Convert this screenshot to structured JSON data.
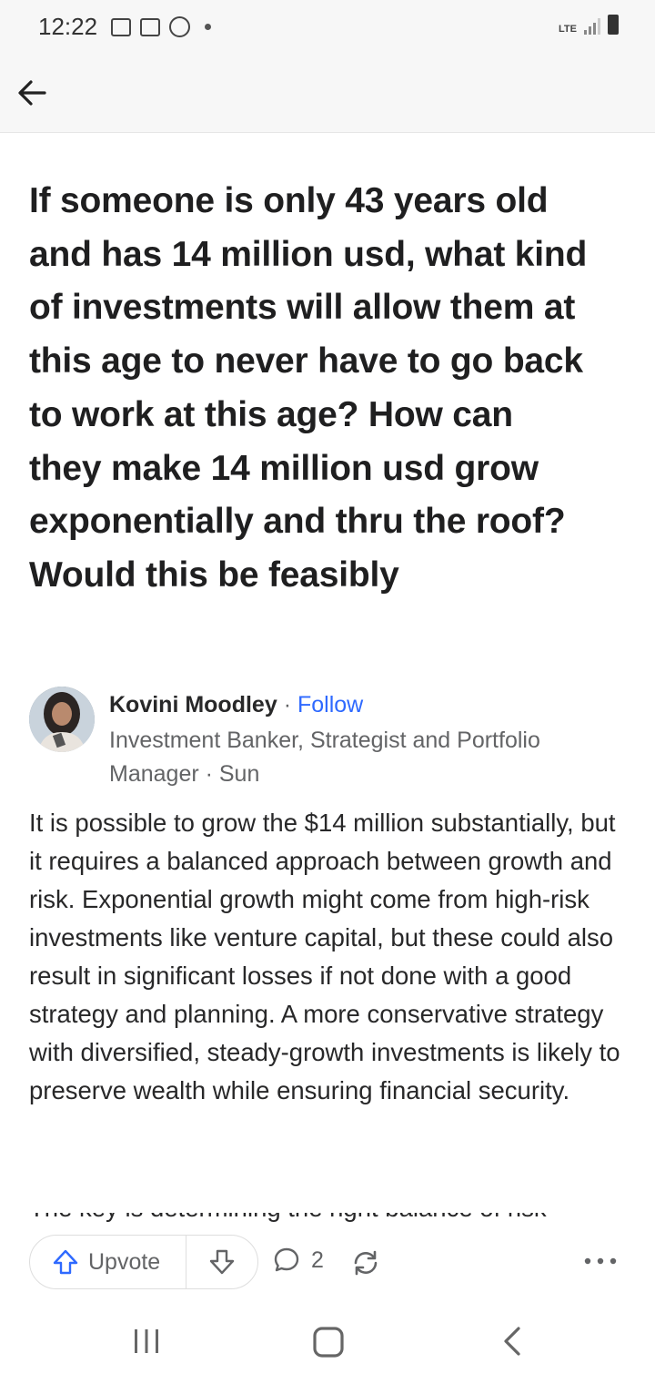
{
  "status": {
    "time": "12:22",
    "network": "LTE"
  },
  "question": {
    "title": "If someone is only 43 years old and has 14 million usd, what kind of investments will allow them at this age to never have to go back to work at this age? How can they make 14 million usd grow exponentially and thru the roof? Would this be feasibly"
  },
  "answer": {
    "author_name": "Kovini Moodley",
    "separator": "·",
    "follow_label": "Follow",
    "credential": "Investment Banker, Strategist and Portfolio Manager · Sun",
    "body": "It is possible to grow the $14 million substantially, but it requires a balanced approach between growth and risk. Exponential growth might come from high-risk investments like venture capital, but these could also result in significant losses if not done with a good strategy and planning. A more conservative strategy with diversified, steady-growth investments is likely to preserve wealth while ensuring financial security.",
    "next_paragraph_cut": "The key is determining the right balance of risk"
  },
  "actions": {
    "upvote_label": "Upvote",
    "comment_count": "2"
  },
  "colors": {
    "accent": "#2e69ff",
    "text": "#282829",
    "muted": "#636466"
  }
}
